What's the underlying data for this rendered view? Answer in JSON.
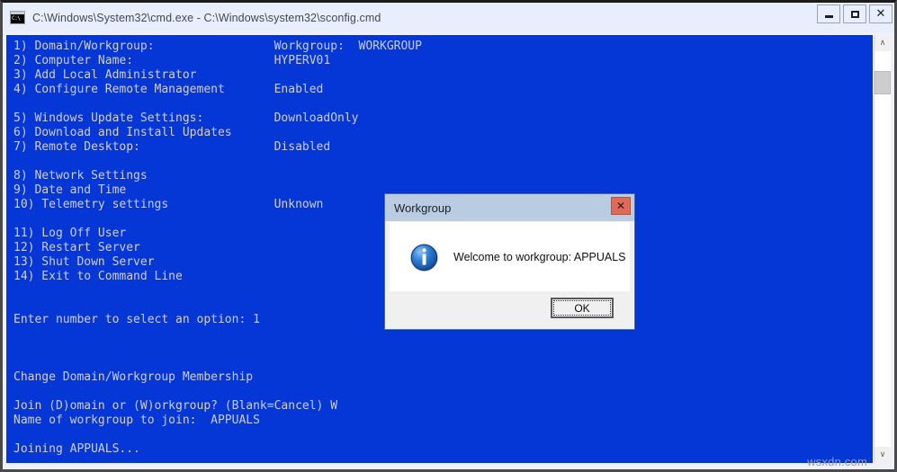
{
  "window": {
    "title": "C:\\Windows\\System32\\cmd.exe - C:\\Windows\\system32\\sconfig.cmd",
    "icon": "cmd-console-icon",
    "icon_text": "C:\\",
    "controls": {
      "minimize_label": "Minimize",
      "maximize_label": "Maximize",
      "close_label": "✕"
    }
  },
  "console": {
    "background_color": "#0437d6",
    "text_color": "#cfcfcf",
    "lines": [
      "1) Domain/Workgroup:                 Workgroup:  WORKGROUP",
      "2) Computer Name:                    HYPERV01",
      "3) Add Local Administrator",
      "4) Configure Remote Management       Enabled",
      "",
      "5) Windows Update Settings:          DownloadOnly",
      "6) Download and Install Updates",
      "7) Remote Desktop:                   Disabled",
      "",
      "8) Network Settings",
      "9) Date and Time",
      "10) Telemetry settings               Unknown",
      "",
      "11) Log Off User",
      "12) Restart Server",
      "13) Shut Down Server",
      "14) Exit to Command Line",
      "",
      "",
      "Enter number to select an option: 1",
      "",
      "",
      "",
      "Change Domain/Workgroup Membership",
      "",
      "Join (D)omain or (W)orkgroup? (Blank=Cancel) W",
      "Name of workgroup to join:  APPUALS",
      "",
      "Joining APPUALS..."
    ],
    "menu_items": [
      {
        "number": "1)",
        "label": "Domain/Workgroup:",
        "value": "Workgroup:  WORKGROUP"
      },
      {
        "number": "2)",
        "label": "Computer Name:",
        "value": "HYPERV01"
      },
      {
        "number": "3)",
        "label": "Add Local Administrator",
        "value": ""
      },
      {
        "number": "4)",
        "label": "Configure Remote Management",
        "value": "Enabled"
      },
      {
        "number": "5)",
        "label": "Windows Update Settings:",
        "value": "DownloadOnly"
      },
      {
        "number": "6)",
        "label": "Download and Install Updates",
        "value": ""
      },
      {
        "number": "7)",
        "label": "Remote Desktop:",
        "value": "Disabled"
      },
      {
        "number": "8)",
        "label": "Network Settings",
        "value": ""
      },
      {
        "number": "9)",
        "label": "Date and Time",
        "value": ""
      },
      {
        "number": "10)",
        "label": "Telemetry settings",
        "value": "Unknown"
      },
      {
        "number": "11)",
        "label": "Log Off User",
        "value": ""
      },
      {
        "number": "12)",
        "label": "Restart Server",
        "value": ""
      },
      {
        "number": "13)",
        "label": "Shut Down Server",
        "value": ""
      },
      {
        "number": "14)",
        "label": "Exit to Command Line",
        "value": ""
      }
    ],
    "prompt_selection": "Enter number to select an option: 1",
    "section_heading": "Change Domain/Workgroup Membership",
    "join_prompt": "Join (D)omain or (W)orkgroup? (Blank=Cancel) W",
    "workgroup_prompt": "Name of workgroup to join:  APPUALS",
    "status_line": "Joining APPUALS..."
  },
  "scrollbar": {
    "up_arrow": "∧",
    "down_arrow": "∨"
  },
  "dialog": {
    "title": "Workgroup",
    "close_label": "✕",
    "icon": "info-icon",
    "message": "Welcome to workgroup: APPUALS",
    "ok_label": "OK"
  },
  "watermark": "wsxdn.com"
}
